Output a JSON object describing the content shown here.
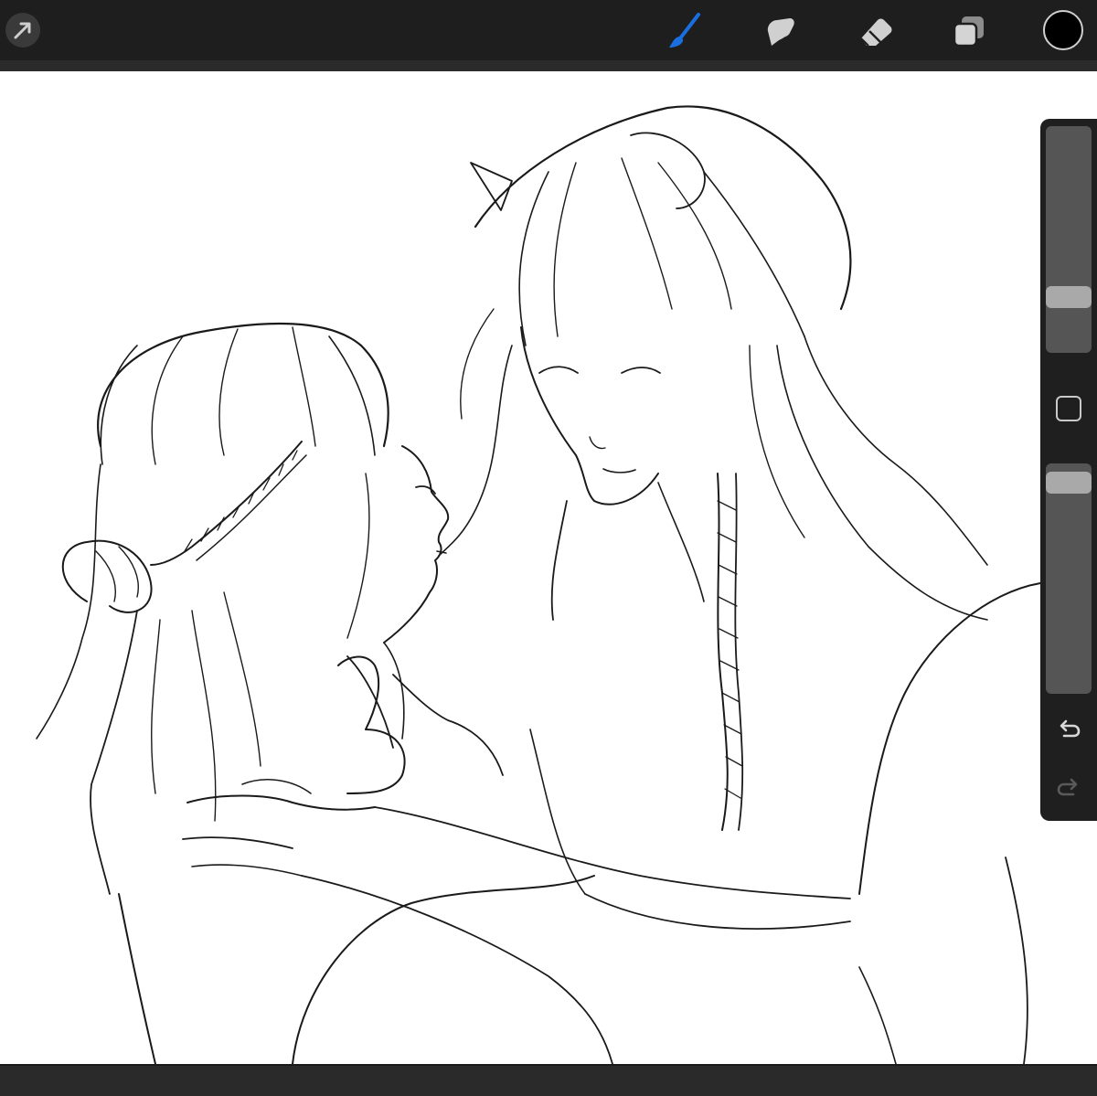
{
  "toolbar": {
    "colors": {
      "background": "#1e1e1e",
      "icon": "#c8c8c8",
      "active_tool": "#1a6fe0",
      "current_color": "#000000"
    },
    "left_tools": [
      {
        "name": "transform",
        "icon": "arrow-cursor-icon",
        "active": false
      }
    ],
    "right_tools": [
      {
        "name": "brush",
        "icon": "brush-icon",
        "active": true
      },
      {
        "name": "smudge",
        "icon": "smudge-icon",
        "active": false
      },
      {
        "name": "eraser",
        "icon": "eraser-icon",
        "active": false
      },
      {
        "name": "layers",
        "icon": "layers-icon",
        "active": false
      }
    ],
    "current_color": "#000000"
  },
  "sidebar": {
    "brush_size_level": 0.22,
    "opacity_level": 0.96,
    "modify_icon": "square-outline-icon",
    "undo_icon": "undo-icon",
    "redo_icon": "redo-icon",
    "redo_enabled": false
  },
  "canvas": {
    "background": "#ffffff",
    "content": "sketch-artwork"
  }
}
